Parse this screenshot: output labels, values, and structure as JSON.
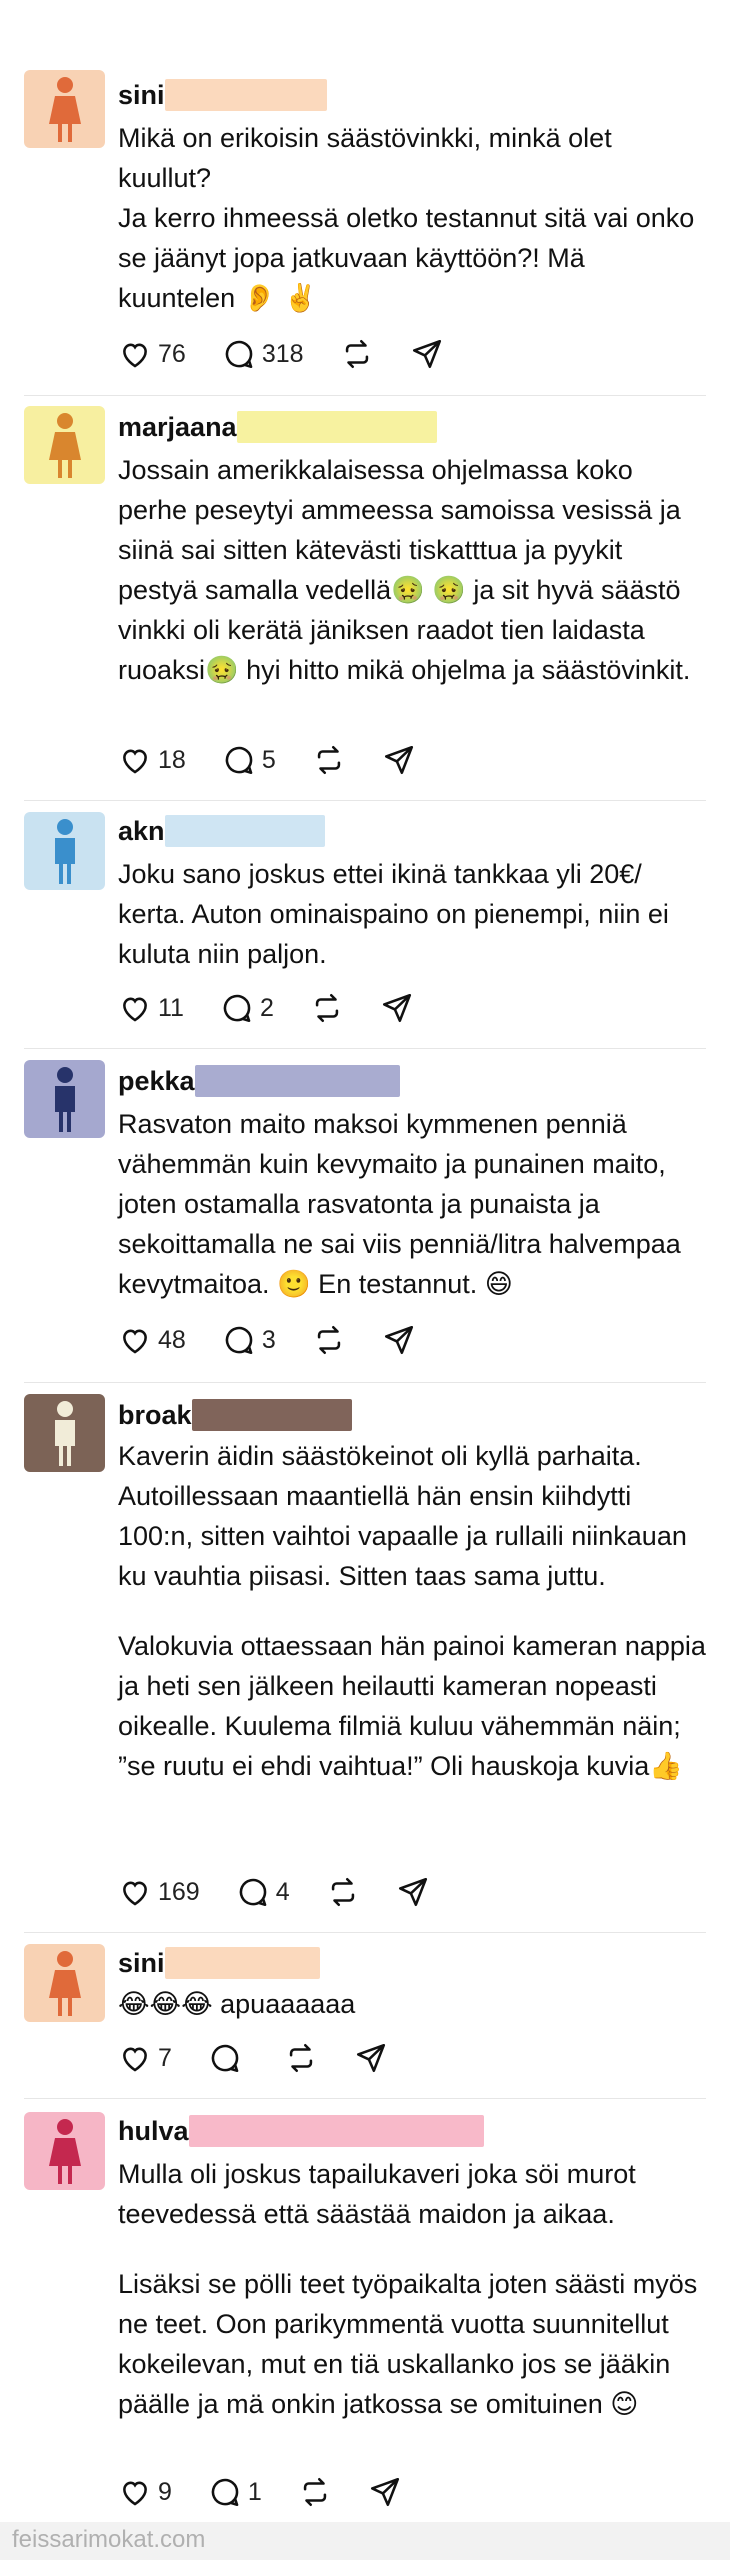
{
  "posts": [
    {
      "username": "sini",
      "name_color": "#fbd9bd",
      "avatar_bg": "#f8d2b4",
      "figure_color": "#e06a3a",
      "paragraphs": [
        "Mikä on erikoisin säästövinkki, minkä olet kuullut?",
        "Ja kerro ihmeessä oletko testannut sitä vai onko se jäänyt jopa jatkuvaan käyttöön?! Mä kuuntelen 👂 ✌️"
      ],
      "likes": "76",
      "comments": "318"
    },
    {
      "username": "marjaana",
      "name_color": "#f7f2a0",
      "avatar_bg": "#f7efa0",
      "figure_color": "#d9862e",
      "paragraphs": [
        "Jossain amerikkalaisessa ohjelmassa koko perhe peseytyi ammeessa samoissa vesissä ja siinä sai sitten kätevästi tiskatttua ja pyykit pestyä samalla vedellä🤢 🤢 ja sit hyvä säästö vinkki oli kerätä jäniksen raadot tien laidasta ruoaksi🤢 hyi hitto mikä ohjelma ja säästövinkit."
      ],
      "likes": "18",
      "comments": "5"
    },
    {
      "username": "akn",
      "name_color": "#cfe5f3",
      "avatar_bg": "#c9e2f1",
      "figure_color": "#3a8fcc",
      "paragraphs": [
        "Joku sano joskus ettei ikinä tankkaa yli 20€/ kerta. Auton ominaispaino on pienempi, niin ei kuluta niin paljon."
      ],
      "likes": "11",
      "comments": "2"
    },
    {
      "username": "pekka",
      "name_color": "#a9acd0",
      "avatar_bg": "#a5a8cf",
      "figure_color": "#27336a",
      "paragraphs": [
        "Rasvaton maito maksoi kymmenen penniä vähemmän kuin kevymaito ja punainen maito, joten ostamalla rasvatonta ja punaista ja sekoittamalla ne sai viis penniä/litra halvempaa kevytmaitoa. 🙂 En testannut. 😄"
      ],
      "likes": "48",
      "comments": "3"
    },
    {
      "username": "broak",
      "name_color": "#80645a",
      "avatar_bg": "#7c6356",
      "figure_color": "#f1ecd8",
      "paragraphs": [
        "Kaverin äidin säästökeinot oli kyllä parhaita. Autoillessaan maantiellä hän ensin kiihdytti 100:n, sitten vaihtoi vapaalle ja rullaili niinkauan ku vauhtia piisasi. Sitten taas sama juttu.",
        "Valokuvia ottaessaan hän painoi kameran nappia ja heti sen jälkeen heilautti kameran nopeasti oikealle. Kuulema filmiä kuluu vähemmän näin; ”se ruutu ei ehdi vaihtua!” Oli hauskoja kuvia👍"
      ],
      "likes": "169",
      "comments": "4"
    },
    {
      "username": "sini",
      "name_color": "#fbd9bd",
      "avatar_bg": "#f8d2b4",
      "figure_color": "#e06a3a",
      "paragraphs": [
        "😂😂😂 apuaaaaaa"
      ],
      "likes": "7",
      "comments": ""
    },
    {
      "username": "hulva",
      "name_color": "#f8b9c9",
      "avatar_bg": "#f6b6c6",
      "figure_color": "#c4284f",
      "paragraphs": [
        "Mulla oli joskus tapailukaveri joka söi murot teevedessä että säästää maidon ja aikaa.",
        "Lisäksi se pölli teet työpaikalta joten säästi myös ne teet. Oon parikymmentä vuotta suunnitellut kokeilevan, mut en tiä uskallanko jos se jääkin päälle ja mä onkin jatkossa se omituinen 😊"
      ],
      "likes": "9",
      "comments": "1"
    }
  ],
  "footer": {
    "text": "feissarimokat.com"
  }
}
